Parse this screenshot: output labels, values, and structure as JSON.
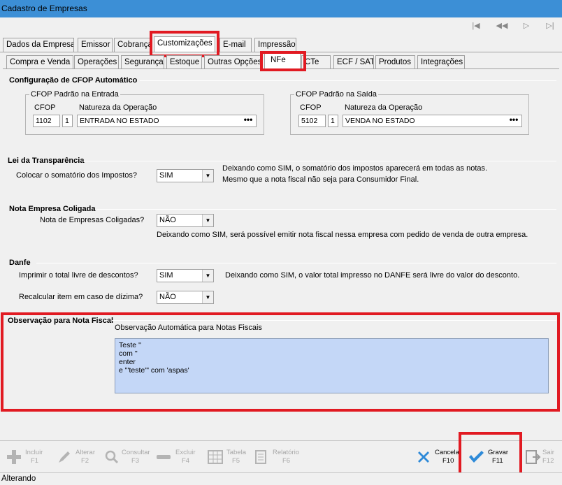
{
  "window": {
    "title": "Cadastro de Empresas"
  },
  "nav": {
    "first": "|◀",
    "prev": "◀◀",
    "next": "▷",
    "last": "▷|"
  },
  "tabs_main": [
    "Dados da Empresa",
    "Emissor",
    "Cobrança",
    "Customizações",
    "E-mail",
    "Impressão"
  ],
  "tabs_sub": [
    "Compra e Venda",
    "Operações",
    "Segurança",
    "Estoque",
    "Outras Opções",
    "NFe",
    "CTe",
    "ECF / SAT",
    "Produtos",
    "Integrações"
  ],
  "cfop": {
    "section_title": "Configuração de CFOP Automático",
    "entrada": {
      "title": "CFOP Padrão na Entrada",
      "col_cfop": "CFOP",
      "col_natureza": "Natureza da Operação",
      "cfop": "1102",
      "seq": "1",
      "natureza": "ENTRADA NO ESTADO",
      "dots": "•••"
    },
    "saida": {
      "title": "CFOP Padrão na Saída",
      "col_cfop": "CFOP",
      "col_natureza": "Natureza da Operação",
      "cfop": "5102",
      "seq": "1",
      "natureza": "VENDA NO ESTADO",
      "dots": "•••"
    }
  },
  "transparencia": {
    "section_title": "Lei da Transparência",
    "label": "Colocar o somatório dos Impostos?",
    "value": "SIM",
    "note1": "Deixando como SIM, o somatório dos impostos aparecerá em todas as notas.",
    "note2": "Mesmo que a nota fiscal não seja para Consumidor Final."
  },
  "coligada": {
    "section_title": "Nota Empresa Coligada",
    "label": "Nota de Empresas Coligadas?",
    "value": "NÃO",
    "note": "Deixando como SIM, será possível emitir nota fiscal nessa empresa com pedido de venda de outra empresa."
  },
  "danfe": {
    "section_title": "Danfe",
    "label1": "Imprimir o total livre de descontos?",
    "value1": "SIM",
    "note1": "Deixando como SIM, o valor total impresso no DANFE será livre do valor do desconto.",
    "label2": "Recalcular item em caso de dízima?",
    "value2": "NÃO"
  },
  "observacao": {
    "section_title": "Observação para Nota Fiscal",
    "label": "Observação Automática para Notas Fiscais",
    "lines": [
      "Teste ''",
      "com ''",
      "enter",
      "e \"'teste'\" com 'aspas'"
    ]
  },
  "toolbar": {
    "incluir": "Incluir",
    "incluir_key": "F1",
    "alterar": "Alterar",
    "alterar_key": "F2",
    "consultar": "Consultar",
    "consultar_key": "F3",
    "excluir": "Excluir",
    "excluir_key": "F4",
    "tabela": "Tabela",
    "tabela_key": "F5",
    "relatorio": "Relatório",
    "relatorio_key": "F6",
    "cancelar": "Cancela",
    "cancelar_key": "F10",
    "gravar": "Gravar",
    "gravar_key": "F11",
    "sair": "Sair",
    "sair_key": "F12"
  },
  "status": {
    "text": "Alterando"
  },
  "colors": {
    "highlight_red": "#e11a22",
    "memo_bg": "#c4d7f7",
    "titlebar": "#3c8fd6"
  }
}
